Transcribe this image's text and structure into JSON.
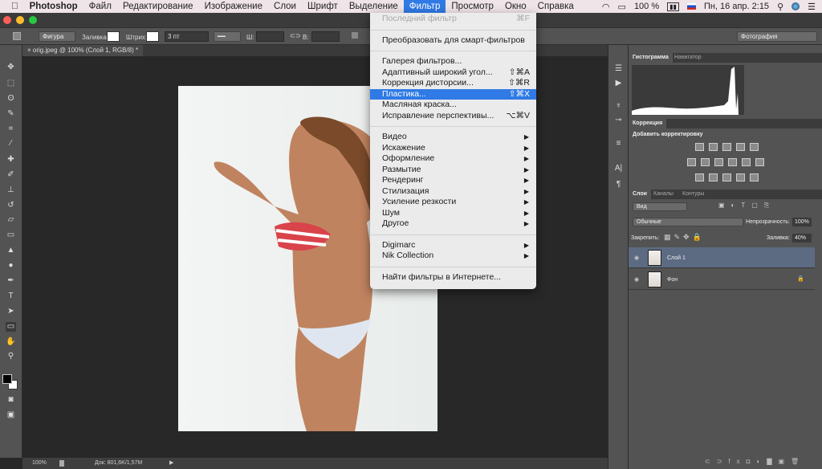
{
  "menubar": {
    "app": "Photoshop",
    "items": [
      "Файл",
      "Редактирование",
      "Изображение",
      "Слои",
      "Шрифт",
      "Выделение",
      "Фильтр",
      "Просмотр",
      "Окно",
      "Справка"
    ],
    "active": "Фильтр",
    "battery": "100 %",
    "datetime": "Пн, 16 апр.  2:15"
  },
  "options": {
    "shape_mode": "Фигура",
    "fill_label": "Заливка:",
    "stroke_label": "Штрих:",
    "stroke_width": "3 пт",
    "w_label": "Ш:",
    "h_label": "В:",
    "workspace": "Фотография"
  },
  "document": {
    "tab_title": "orig.jpeg @ 100% (Слой 1, RGB/8) *",
    "zoom": "100%",
    "doc_info": "Док: 801,6K/1,57M"
  },
  "panels": {
    "histogram_tab": "Гистограмма",
    "navigator_tab": "Навигатор",
    "adjustments_tab": "Коррекция",
    "add_adjustment": "Добавить корректировку",
    "layers_tab": "Слои",
    "channels_tab": "Каналы",
    "paths_tab": "Контуры",
    "filter_kind": "Вид",
    "blend_mode": "Обычные",
    "opacity_label": "Непрозрачность:",
    "opacity": "100%",
    "lock_label": "Закрепить:",
    "fill_label": "Заливка:",
    "fill": "40%",
    "layers": [
      {
        "name": "Слой 1",
        "selected": true
      },
      {
        "name": "Фон",
        "locked": true
      }
    ]
  },
  "filter_menu": {
    "last_filter": {
      "label": "Последний фильтр",
      "shortcut": "⌘F"
    },
    "smart": "Преобразовать для смарт-фильтров",
    "group1": [
      {
        "label": "Галерея фильтров...",
        "shortcut": ""
      },
      {
        "label": "Адаптивный широкий угол...",
        "shortcut": "⇧⌘A"
      },
      {
        "label": "Коррекция дисторсии...",
        "shortcut": "⇧⌘R"
      },
      {
        "label": "Пластика...",
        "shortcut": "⇧⌘X"
      },
      {
        "label": "Масляная краска...",
        "shortcut": ""
      },
      {
        "label": "Исправление перспективы...",
        "shortcut": "⌥⌘V"
      }
    ],
    "group2": [
      "Видео",
      "Искажение",
      "Оформление",
      "Размытие",
      "Рендеринг",
      "Стилизация",
      "Усиление резкости",
      "Шум",
      "Другое"
    ],
    "group3": [
      "Digimarc",
      "Nik Collection"
    ],
    "online": "Найти фильтры в Интернете...",
    "highlighted": "Пластика..."
  },
  "colors": {
    "accent": "#2f7ae5",
    "panel": "#535353",
    "canvas": "#282828"
  }
}
